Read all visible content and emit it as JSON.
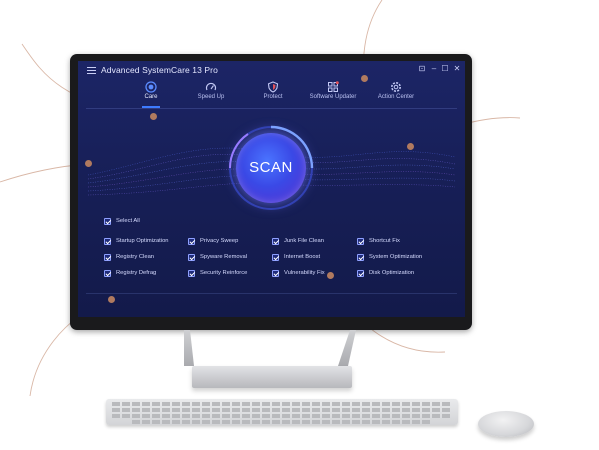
{
  "app": {
    "title": "Advanced SystemCare 13 Pro"
  },
  "window_controls": [
    {
      "name": "store-icon",
      "glyph": "⊡"
    },
    {
      "name": "minimize-icon",
      "glyph": "–"
    },
    {
      "name": "maximize-icon",
      "glyph": "☐"
    },
    {
      "name": "close-icon",
      "glyph": "✕"
    }
  ],
  "nav": {
    "tabs": [
      {
        "label": "Care",
        "icon": "care-icon",
        "active": true
      },
      {
        "label": "Speed Up",
        "icon": "speedometer-icon",
        "active": false
      },
      {
        "label": "Protect",
        "icon": "shield-icon",
        "active": false
      },
      {
        "label": "Software Updater",
        "icon": "update-icon",
        "active": false
      },
      {
        "label": "Action Center",
        "icon": "gear-icon",
        "active": false
      }
    ]
  },
  "scan": {
    "label": "SCAN"
  },
  "select_all": {
    "label": "Select All",
    "checked": true
  },
  "options": [
    {
      "label": "Startup Optimization",
      "checked": true
    },
    {
      "label": "Privacy Sweep",
      "checked": true
    },
    {
      "label": "Junk File Clean",
      "checked": true
    },
    {
      "label": "Shortcut Fix",
      "checked": true
    },
    {
      "label": "Registry Clean",
      "checked": true
    },
    {
      "label": "Spyware Removal",
      "checked": true
    },
    {
      "label": "Internet Boost",
      "checked": true
    },
    {
      "label": "System Optimization",
      "checked": true
    },
    {
      "label": "Registry Defrag",
      "checked": true
    },
    {
      "label": "Security Reinforce",
      "checked": true
    },
    {
      "label": "Vulnerability Fix",
      "checked": true
    },
    {
      "label": "Disk Optimization",
      "checked": true
    }
  ],
  "colors": {
    "screen_bg": "#171f57",
    "accent": "#3d7bff",
    "scan_button": "#3a49e6",
    "callout": "#b07a5f"
  }
}
